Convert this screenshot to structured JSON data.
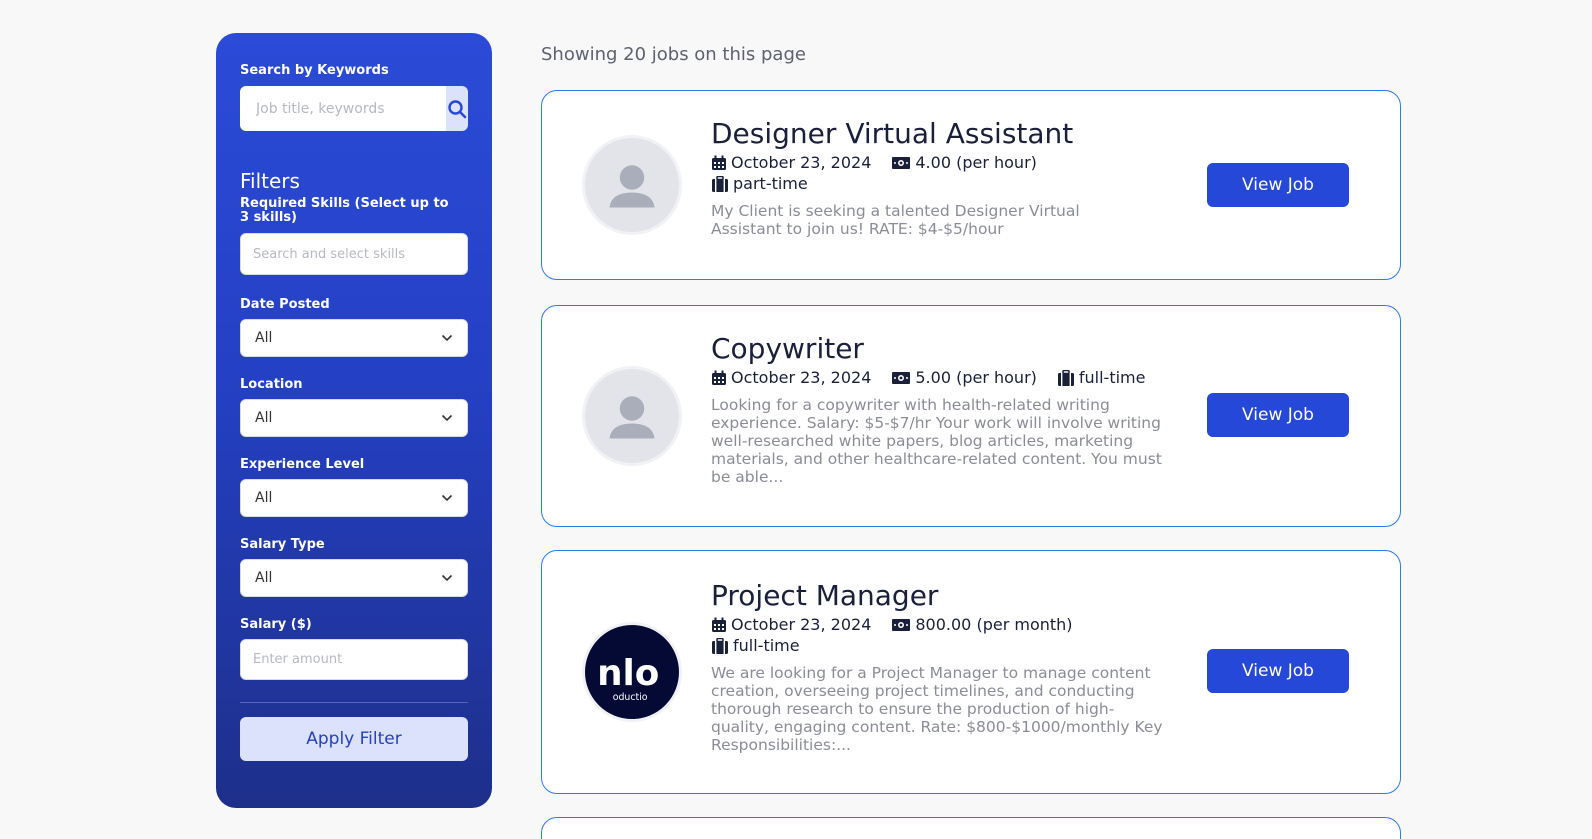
{
  "sidebar": {
    "search_label": "Search by Keywords",
    "search_placeholder": "Job title, keywords",
    "filters_title": "Filters",
    "skills_label": "Required Skills (Select up to 3 skills)",
    "skills_placeholder": "Search and select skills",
    "date_label": "Date Posted",
    "date_value": "All",
    "location_label": "Location",
    "location_value": "All",
    "experience_label": "Experience Level",
    "experience_value": "All",
    "salary_type_label": "Salary Type",
    "salary_type_value": "All",
    "salary_label": "Salary ($)",
    "salary_placeholder": "Enter amount",
    "apply_label": "Apply Filter"
  },
  "main": {
    "showing_text": "Showing 20 jobs on this page",
    "view_label": "View Job",
    "jobs": [
      {
        "title": "Designer Virtual Assistant",
        "date": "October 23, 2024",
        "salary": "4.00 (per hour)",
        "type": "part-time",
        "description": "My Client is seeking a talented Designer Virtual Assistant to join us! RATE: $4-$5/hour",
        "logo": "user-placeholder-icon"
      },
      {
        "title": "Copywriter",
        "date": "October 23, 2024",
        "salary": "5.00 (per hour)",
        "type": "full-time",
        "description": "Looking for a copywriter with health-related writing experience. Salary: $5-$7/hr Your work will involve writing well-researched white papers, blog articles, marketing materials, and other healthcare-related content. You must be able...",
        "logo": "user-placeholder-icon"
      },
      {
        "title": "Project Manager",
        "date": "October 23, 2024",
        "salary": "800.00 (per month)",
        "type": "full-time",
        "description": "We are looking for a Project Manager to manage content creation, overseeing project timelines, and conducting thorough research to ensure the production of high-quality, engaging content. Rate: $800-$1000/monthly Key Responsibilities:...",
        "logo": "company-logo",
        "logo_text": "nlo",
        "logo_subtext": "oductio"
      }
    ]
  },
  "colors": {
    "accent": "#2648d8",
    "card_border": "#2a7cf0",
    "sidebar_top": "#2b4bd8",
    "sidebar_bottom": "#1e2f8a"
  }
}
